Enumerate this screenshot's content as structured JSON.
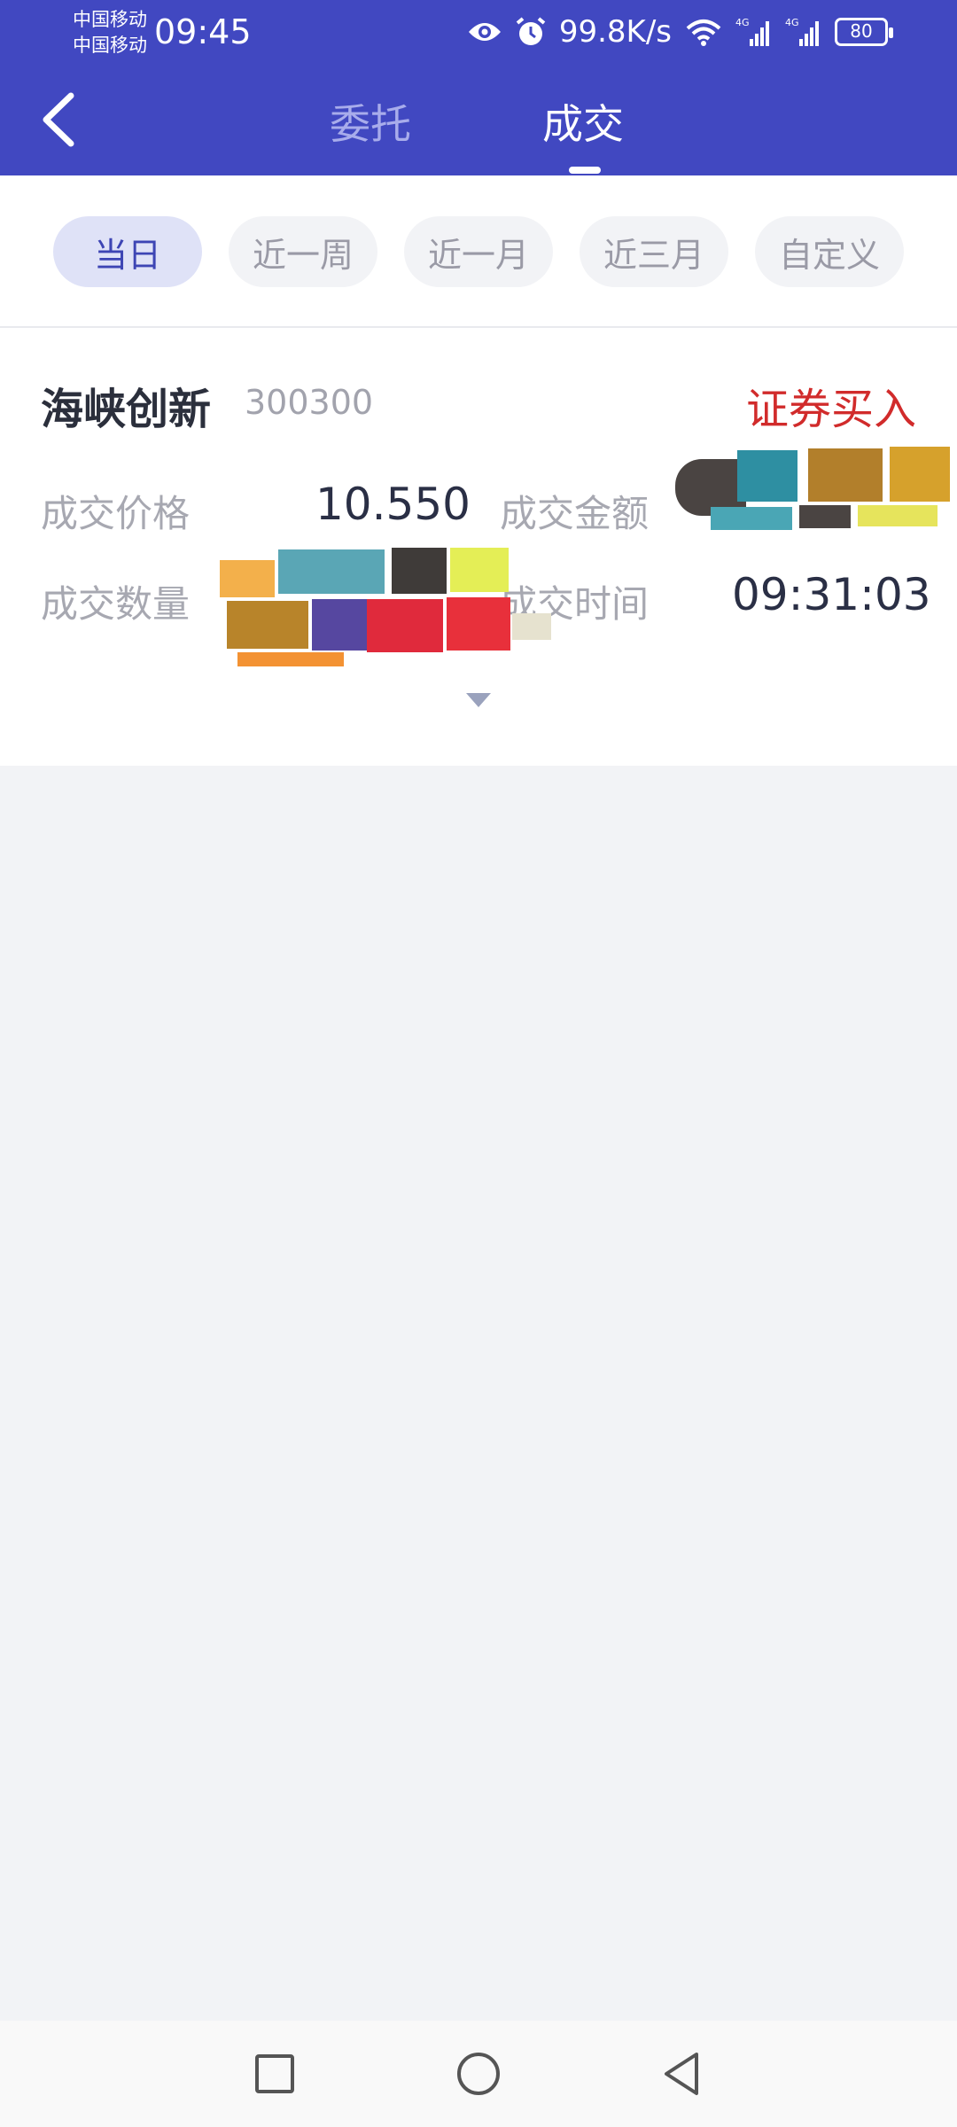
{
  "status_bar": {
    "carrier_1": "中国移动",
    "carrier_2": "中国移动",
    "time": "09:45",
    "network_speed": "99.8K/s",
    "signal_1_type": "4G",
    "signal_2_type": "4G",
    "battery": "80",
    "icons": [
      "eye-icon",
      "alarm-icon",
      "wifi-icon",
      "signal-icon",
      "signal-icon",
      "battery-icon"
    ]
  },
  "header": {
    "tabs": [
      {
        "label": "委托",
        "active": false
      },
      {
        "label": "成交",
        "active": true
      }
    ]
  },
  "filters": [
    {
      "label": "当日",
      "active": true
    },
    {
      "label": "近一周",
      "active": false
    },
    {
      "label": "近一月",
      "active": false
    },
    {
      "label": "近三月",
      "active": false
    },
    {
      "label": "自定义",
      "active": false
    }
  ],
  "trade": {
    "stock_name": "海峡创新",
    "stock_code": "300300",
    "trade_type": "证券买入",
    "price_label": "成交价格",
    "price_value": "10.550",
    "amount_label": "成交金额",
    "quantity_label": "成交数量",
    "time_label": "成交时间",
    "time_value": "09:31:03"
  },
  "colors": {
    "header_bg": "#4148c1",
    "accent": "#3d45b4",
    "buy_red": "#d12b2b",
    "page_bg": "#f2f3f6"
  }
}
